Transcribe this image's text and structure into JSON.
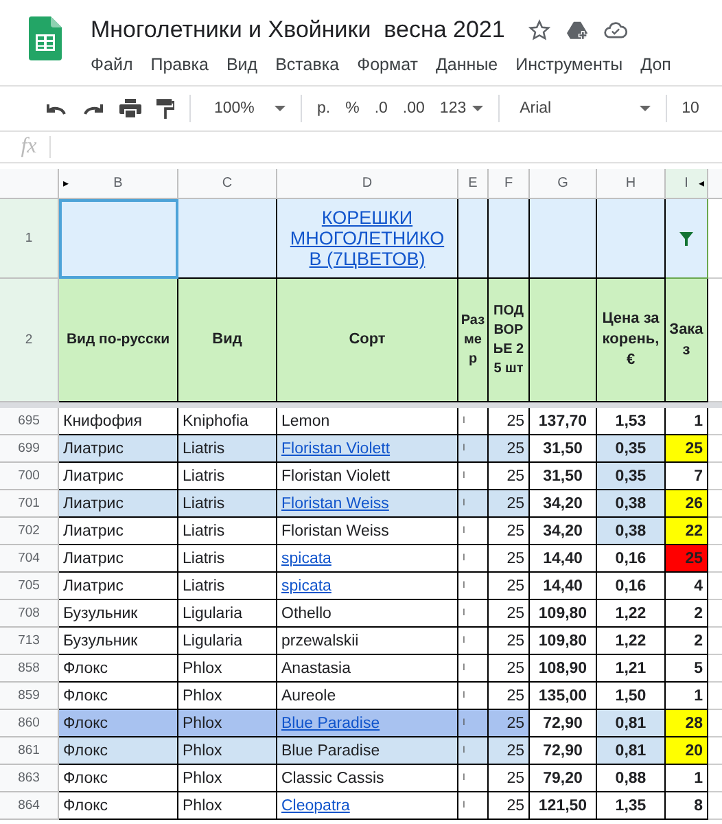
{
  "document": {
    "title": "Многолетники и Хвойники  весна 2021"
  },
  "menu": [
    "Файл",
    "Правка",
    "Вид",
    "Вставка",
    "Формат",
    "Данные",
    "Инструменты",
    "Доп"
  ],
  "toolbar": {
    "zoom": "100%",
    "currency": "р.",
    "percent": "%",
    "decrease_decimals": ".0",
    "increase_decimals": ".00",
    "number_format": "123",
    "font": "Arial",
    "font_size": "10"
  },
  "formula_bar": {
    "label": "fx"
  },
  "columns": [
    {
      "label": "B",
      "collapse_marker": "▸"
    },
    {
      "label": "C"
    },
    {
      "label": "D"
    },
    {
      "label": "E"
    },
    {
      "label": "F"
    },
    {
      "label": "G"
    },
    {
      "label": "H"
    },
    {
      "label": "I",
      "collapse_marker_right": "◂",
      "selected": true
    }
  ],
  "title_row": {
    "number": "1",
    "title": "КОРЕШКИ МНОГОЛЕТНИКО В (7ЦВЕТОВ)",
    "filter": true
  },
  "header_row": {
    "number": "2",
    "cells": [
      "Вид по-русски",
      "Вид",
      "Сорт",
      "Размер",
      "ПОДВОРЬЕ 25 шт",
      "",
      "Цена за корень, €",
      "Заказ"
    ]
  },
  "rows": [
    {
      "number": "695",
      "ru": "Книфофия",
      "latin": "Kniphofia",
      "variety": "Lemon",
      "link": false,
      "size": "I",
      "qty": "25",
      "price": "137,70",
      "unit": "1,53",
      "order": "1",
      "highlighted": false,
      "selected": false,
      "unit_highlight": false
    },
    {
      "number": "699",
      "ru": "Лиатрис",
      "latin": "Liatris",
      "variety": "Floristan Violett",
      "link": true,
      "size": "I",
      "qty": "25",
      "price": "31,50",
      "unit": "0,35",
      "order": "25",
      "color": "#ffff00",
      "highlighted": true,
      "selected": false,
      "unit_highlight": true
    },
    {
      "number": "700",
      "ru": "Лиатрис",
      "latin": "Liatris",
      "variety": "Floristan Violett",
      "link": false,
      "size": "I",
      "qty": "25",
      "price": "31,50",
      "unit": "0,35",
      "order": "7",
      "highlighted": false,
      "selected": false,
      "unit_highlight": true
    },
    {
      "number": "701",
      "ru": "Лиатрис",
      "latin": "Liatris",
      "variety": "Floristan Weiss",
      "link": true,
      "size": "I",
      "qty": "25",
      "price": "34,20",
      "unit": "0,38",
      "order": "26",
      "color": "#ffff00",
      "highlighted": true,
      "selected": false,
      "unit_highlight": true
    },
    {
      "number": "702",
      "ru": "Лиатрис",
      "latin": "Liatris",
      "variety": "Floristan Weiss",
      "link": false,
      "size": "I",
      "qty": "25",
      "price": "34,20",
      "unit": "0,38",
      "order": "22",
      "color": "#ffff00",
      "highlighted": false,
      "selected": false,
      "unit_highlight": true
    },
    {
      "number": "704",
      "ru": "Лиатрис",
      "latin": "Liatris",
      "variety": "spicata",
      "link": true,
      "size": "I",
      "qty": "25",
      "price": "14,40",
      "unit": "0,16",
      "order": "25",
      "color": "#ff0000",
      "highlighted": false,
      "selected": false,
      "unit_highlight": false
    },
    {
      "number": "705",
      "ru": "Лиатрис",
      "latin": "Liatris",
      "variety": "spicata",
      "link": true,
      "size": "I",
      "qty": "25",
      "price": "14,40",
      "unit": "0,16",
      "order": "4",
      "highlighted": false,
      "selected": false,
      "unit_highlight": false
    },
    {
      "number": "708",
      "ru": "Бузульник",
      "latin": "Ligularia",
      "variety": "Othello",
      "link": false,
      "size": "I",
      "qty": "25",
      "price": "109,80",
      "unit": "1,22",
      "order": "2",
      "highlighted": false,
      "selected": false,
      "unit_highlight": false
    },
    {
      "number": "713",
      "ru": "Бузульник",
      "latin": "Ligularia",
      "variety": "przewalskii",
      "link": false,
      "size": "I",
      "qty": "25",
      "price": "109,80",
      "unit": "1,22",
      "order": "2",
      "highlighted": false,
      "selected": false,
      "unit_highlight": false
    },
    {
      "number": "858",
      "ru": "Флокс",
      "latin": "Phlox",
      "variety": "Anastasia",
      "link": false,
      "size": "I",
      "qty": "25",
      "price": "108,90",
      "unit": "1,21",
      "order": "5",
      "highlighted": false,
      "selected": false,
      "unit_highlight": false
    },
    {
      "number": "859",
      "ru": "Флокс",
      "latin": "Phlox",
      "variety": "Aureole",
      "link": false,
      "size": "I",
      "qty": "25",
      "price": "135,00",
      "unit": "1,50",
      "order": "1",
      "highlighted": false,
      "selected": false,
      "unit_highlight": false
    },
    {
      "number": "860",
      "ru": "Флокс",
      "latin": "Phlox",
      "variety": "Blue Paradise",
      "link": true,
      "size": "I",
      "qty": "25",
      "price": "72,90",
      "unit": "0,81",
      "order": "28",
      "color": "#ffff00",
      "highlighted": true,
      "selected": true,
      "unit_highlight": true
    },
    {
      "number": "861",
      "ru": "Флокс",
      "latin": "Phlox",
      "variety": "Blue Paradise",
      "link": false,
      "size": "I",
      "qty": "25",
      "price": "72,90",
      "unit": "0,81",
      "order": "20",
      "color": "#ffff00",
      "highlighted": true,
      "selected": false,
      "unit_highlight": true
    },
    {
      "number": "863",
      "ru": "Флокс",
      "latin": "Phlox",
      "variety": "Classic Cassis",
      "link": false,
      "size": "I",
      "qty": "25",
      "price": "79,20",
      "unit": "0,88",
      "order": "1",
      "highlighted": false,
      "selected": false,
      "unit_highlight": false
    },
    {
      "number": "864",
      "ru": "Флокс",
      "latin": "Phlox",
      "variety": "Cleopatra",
      "link": true,
      "size": "I",
      "qty": "25",
      "price": "121,50",
      "unit": "1,35",
      "order": "8",
      "highlighted": false,
      "selected": false,
      "unit_highlight": false
    }
  ]
}
